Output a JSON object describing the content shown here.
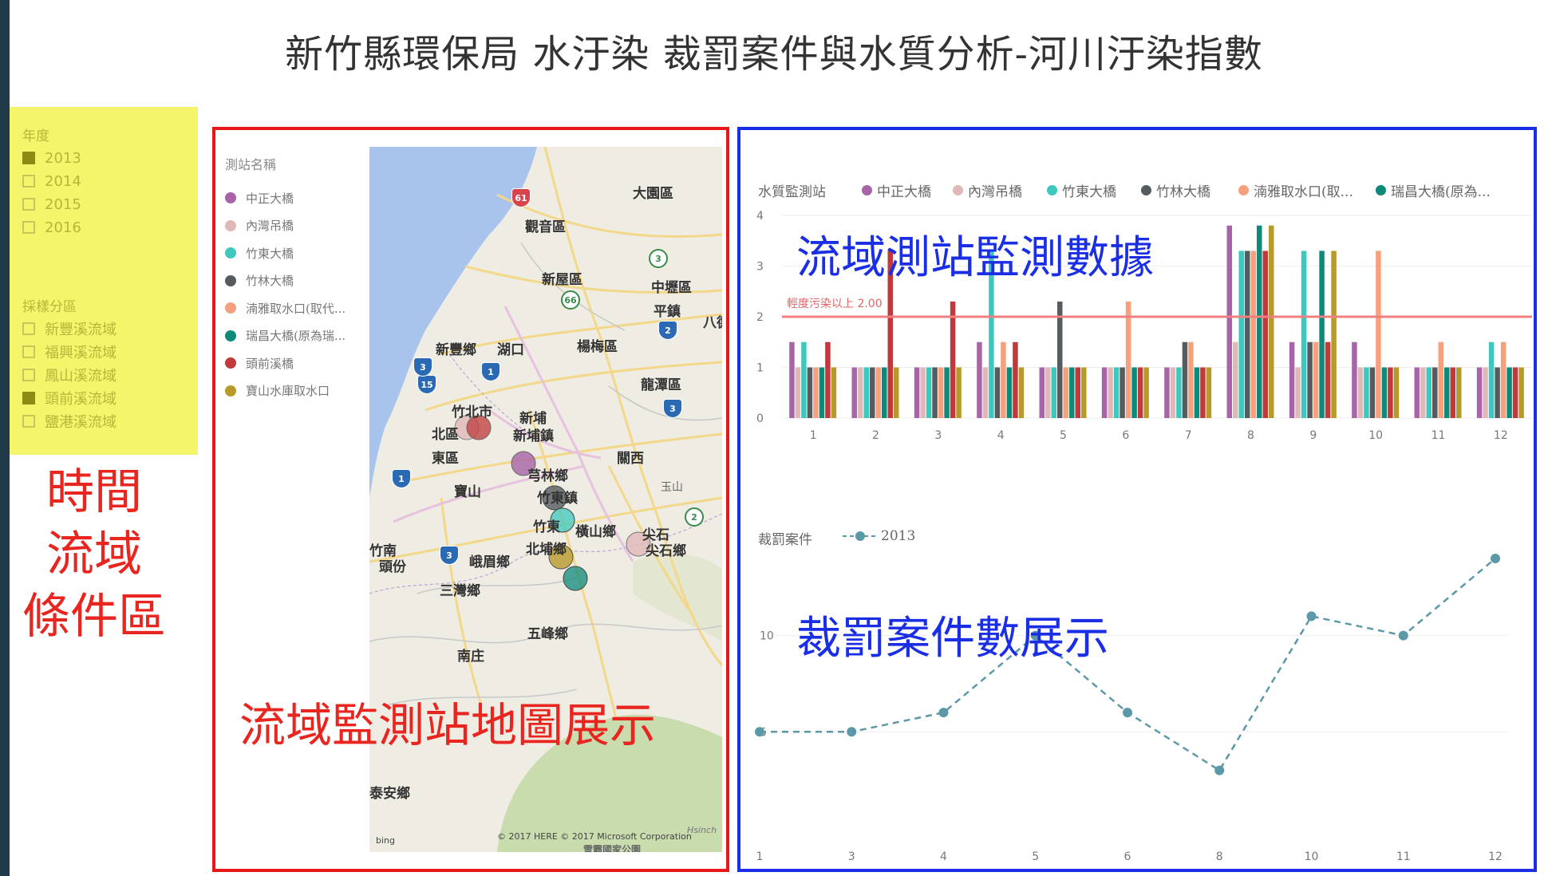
{
  "title": "新竹縣環保局 水汙染 裁罰案件與水質分析-河川汙染指數",
  "slicer": {
    "year_title": "年度",
    "years": [
      {
        "label": "2013",
        "checked": true
      },
      {
        "label": "2014",
        "checked": false
      },
      {
        "label": "2015",
        "checked": false
      },
      {
        "label": "2016",
        "checked": false
      }
    ],
    "area_title": "採樣分區",
    "areas": [
      {
        "label": "新豐溪流域",
        "checked": false
      },
      {
        "label": "福興溪流域",
        "checked": false
      },
      {
        "label": "鳳山溪流域",
        "checked": false
      },
      {
        "label": "頭前溪流域",
        "checked": true
      },
      {
        "label": "鹽港溪流域",
        "checked": false
      }
    ]
  },
  "condition_caption": [
    "時間",
    "流域",
    "條件區"
  ],
  "map_legend": {
    "title": "測站名稱",
    "items": [
      {
        "label": "中正大橋",
        "color": "#a864a8"
      },
      {
        "label": "內灣吊橋",
        "color": "#e0b8b8"
      },
      {
        "label": "竹東大橋",
        "color": "#3cc8be"
      },
      {
        "label": "竹林大橋",
        "color": "#555c60"
      },
      {
        "label": "湳雅取水口(取代...",
        "color": "#f7a07e"
      },
      {
        "label": "瑞昌大橋(原為瑞...",
        "color": "#0d8a7a"
      },
      {
        "label": "頭前溪橋",
        "color": "#c0393b"
      },
      {
        "label": "寶山水庫取水口",
        "color": "#b89a2a"
      }
    ]
  },
  "map": {
    "place_labels": [
      "大園區",
      "觀音區",
      "新屋區",
      "中壢區",
      "平鎮",
      "八德",
      "新豐鄉",
      "湖口",
      "楊梅區",
      "龍潭區",
      "竹北市",
      "北區",
      "東區",
      "新埔",
      "新埔鎮",
      "芎林鄉",
      "關西",
      "寶山",
      "竹東鎮",
      "竹東",
      "橫山鄉",
      "尖石",
      "尖石鄉",
      "竹南",
      "頭份",
      "峨眉鄉",
      "北埔鄉",
      "三灣鄉",
      "五峰鄉",
      "南庄",
      "泰安鄉",
      "玉山"
    ],
    "road_shields": [
      "61",
      "66",
      "15",
      "1",
      "1",
      "3",
      "3",
      "2",
      "3",
      "2",
      "3"
    ],
    "copyright": "© 2017 HERE   © 2017 Microsoft Corporation",
    "watermark": "Hsinch",
    "bing": "bing",
    "park": "雪霸國家公園"
  },
  "map_caption": "流域監測站地圖展示",
  "bar_caption": "流域測站監測數據",
  "line_caption": "裁罰案件數展示",
  "bar_legend_title": "水質監測站",
  "bar_legend": [
    {
      "label": "中正大橋",
      "color": "#a864a8"
    },
    {
      "label": "內灣吊橋",
      "color": "#e0b8b8"
    },
    {
      "label": "竹東大橋",
      "color": "#3cc8be"
    },
    {
      "label": "竹林大橋",
      "color": "#555c60"
    },
    {
      "label": "湳雅取水口(取...",
      "color": "#f7a07e"
    },
    {
      "label": "瑞昌大橋(原為...",
      "color": "#0d8a7a"
    }
  ],
  "line_legend_title": "裁罰案件",
  "line_legend_series": "2013",
  "chart_data": [
    {
      "type": "bar",
      "categories": [
        "1",
        "2",
        "3",
        "4",
        "5",
        "6",
        "7",
        "8",
        "9",
        "10",
        "11",
        "12"
      ],
      "ylim": [
        0,
        4
      ],
      "yticks": [
        "0",
        "1",
        "2",
        "3",
        "4"
      ],
      "reference_line": {
        "value": 2,
        "label": "輕度污染以上 2.00"
      },
      "series": [
        {
          "name": "中正大橋",
          "values": [
            1.5,
            1,
            1,
            1.5,
            1,
            1,
            1,
            3.8,
            1.5,
            1.5,
            1,
            1
          ]
        },
        {
          "name": "內灣吊橋",
          "values": [
            1,
            1,
            1,
            1,
            1,
            1,
            1,
            1.5,
            1,
            1,
            1,
            1
          ]
        },
        {
          "name": "竹東大橋",
          "values": [
            1.5,
            1,
            1,
            3.3,
            1,
            1,
            1,
            3.3,
            3.3,
            1,
            1,
            1.5
          ]
        },
        {
          "name": "竹林大橋",
          "values": [
            1,
            1,
            1,
            1,
            2.3,
            1,
            1.5,
            3.3,
            1.5,
            1,
            1,
            1
          ]
        },
        {
          "name": "湳雅取水口(取...",
          "values": [
            1,
            1,
            1,
            1.5,
            1,
            2.3,
            1.5,
            3.3,
            1.5,
            3.3,
            1.5,
            1.5
          ]
        },
        {
          "name": "瑞昌大橋(原為...",
          "values": [
            1,
            1,
            1,
            1,
            1,
            1,
            1,
            3.8,
            3.3,
            1,
            1,
            1
          ]
        },
        {
          "name": "頭前溪橋",
          "values": [
            1.5,
            3.3,
            2.3,
            1.5,
            1,
            1,
            1,
            3.3,
            1.5,
            1,
            1,
            1
          ]
        },
        {
          "name": "寶山水庫取水口",
          "values": [
            1,
            1,
            1,
            1,
            1,
            1,
            1,
            3.8,
            3.3,
            1,
            1,
            1
          ]
        }
      ]
    },
    {
      "type": "line",
      "x": [
        "1",
        "3",
        "4",
        "5",
        "6",
        "8",
        "10",
        "11",
        "12"
      ],
      "series": [
        {
          "name": "2013",
          "values": [
            5,
            5,
            6,
            10,
            6,
            3,
            11,
            10,
            14
          ]
        }
      ],
      "yticks": [
        "5",
        "10"
      ],
      "ylim": [
        0,
        14
      ],
      "style": "dashed"
    }
  ]
}
